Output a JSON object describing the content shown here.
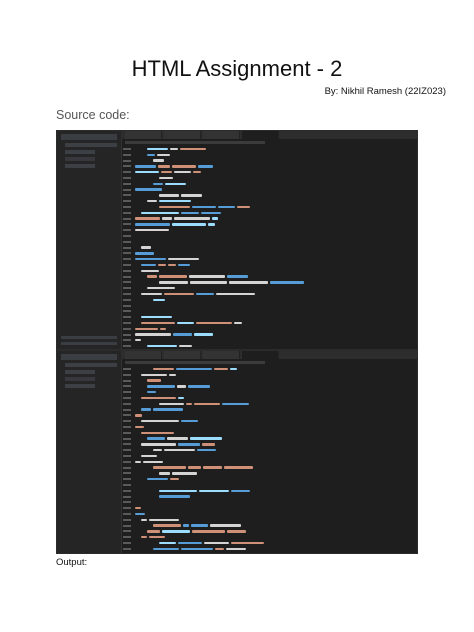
{
  "header": {
    "title": "HTML Assignment - 2",
    "byline": "By: Nikhil Ramesh (22IZ023)"
  },
  "sections": {
    "source_code": "Source code:",
    "output": "Output:"
  },
  "screenshots": [
    {
      "name": "editor-screenshot-1",
      "tab_count": 4,
      "line_count": 40
    },
    {
      "name": "editor-screenshot-2",
      "tab_count": 4,
      "line_count": 38
    }
  ]
}
